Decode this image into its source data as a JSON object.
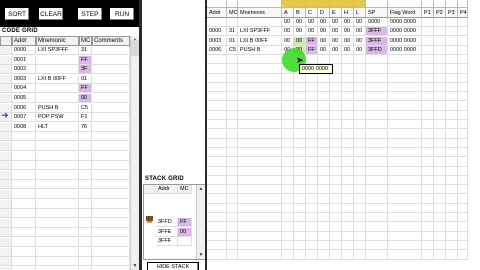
{
  "toolbar": {
    "sort_label": "SORT",
    "clear_label": "CLEAR",
    "step_label": "STEP",
    "run_label": "RUN"
  },
  "code_grid": {
    "title": "CODE GRID",
    "columns": [
      "Addr",
      "Mnemonic",
      "MC",
      "Comments"
    ],
    "rows": [
      {
        "addr": "0000",
        "mnemonic": "LXI SP3FFF",
        "mc": "31"
      },
      {
        "addr": "0001",
        "mnemonic": "",
        "mc": "FF"
      },
      {
        "addr": "0002",
        "mnemonic": "",
        "mc": "3F"
      },
      {
        "addr": "0003",
        "mnemonic": "LXI B 00FF",
        "mc": "01"
      },
      {
        "addr": "0004",
        "mnemonic": "",
        "mc": "FF"
      },
      {
        "addr": "0005",
        "mnemonic": "",
        "mc": "00"
      },
      {
        "addr": "0006",
        "mnemonic": "PUSH B",
        "mc": "C5"
      },
      {
        "addr": "0007",
        "mnemonic": "POP PSW",
        "mc": "F1"
      },
      {
        "addr": "0008",
        "mnemonic": "HLT",
        "mc": "76"
      }
    ]
  },
  "register_grid": {
    "columns": [
      "Addr",
      "MC",
      "Mnemonic",
      "A",
      "B",
      "C",
      "D",
      "E",
      "H",
      "L",
      "SP",
      "Flag Word",
      "P1",
      "P2",
      "P3",
      "P4"
    ],
    "rows": [
      {
        "addr": "",
        "mc": "",
        "mnemonic": "",
        "a": "00",
        "b": "00",
        "c": "00",
        "d": "00",
        "e": "00",
        "h": "00",
        "l": "00",
        "sp": "0000",
        "flag": "0000 0000"
      },
      {
        "addr": "0000",
        "mc": "31",
        "mnemonic": "LXI SP3FFF",
        "a": "00",
        "b": "00",
        "c": "00",
        "d": "00",
        "e": "00",
        "h": "00",
        "l": "00",
        "sp": "3FFF",
        "flag": "0000 0000"
      },
      {
        "addr": "0003",
        "mc": "01",
        "mnemonic": "LXI B 00FF",
        "a": "00",
        "b": "00",
        "c": "FF",
        "d": "00",
        "e": "00",
        "h": "00",
        "l": "00",
        "sp": "3FFF",
        "flag": "0000 0000"
      },
      {
        "addr": "0006",
        "mc": "C5",
        "mnemonic": "PUSH B",
        "a": "00",
        "b": "00",
        "c": "FF",
        "d": "00",
        "e": "00",
        "h": "00",
        "l": "00",
        "sp": "3FFD",
        "flag": "0000 0000"
      }
    ],
    "tooltip": "0000 0000"
  },
  "stack_grid": {
    "title": "STACK GRID",
    "columns": [
      "Addr",
      "MC"
    ],
    "rows": [
      {
        "addr": "3FFD",
        "mc": "FF"
      },
      {
        "addr": "3FFE",
        "mc": "00"
      },
      {
        "addr": "3FFF",
        "mc": ""
      }
    ],
    "hide_label": "HIDE STACK"
  },
  "icons": {
    "current_line_pointer": "arrow-right-icon",
    "stack_pointer": "stack-pointer-icon",
    "mouse_cursor": "cursor-icon"
  },
  "colors": {
    "highlight_purple": "#d9b8e8",
    "highlight_green": "#cfe8b0",
    "cursor_green": "#3cdc28",
    "pointer_blue": "#1d3ecf"
  }
}
